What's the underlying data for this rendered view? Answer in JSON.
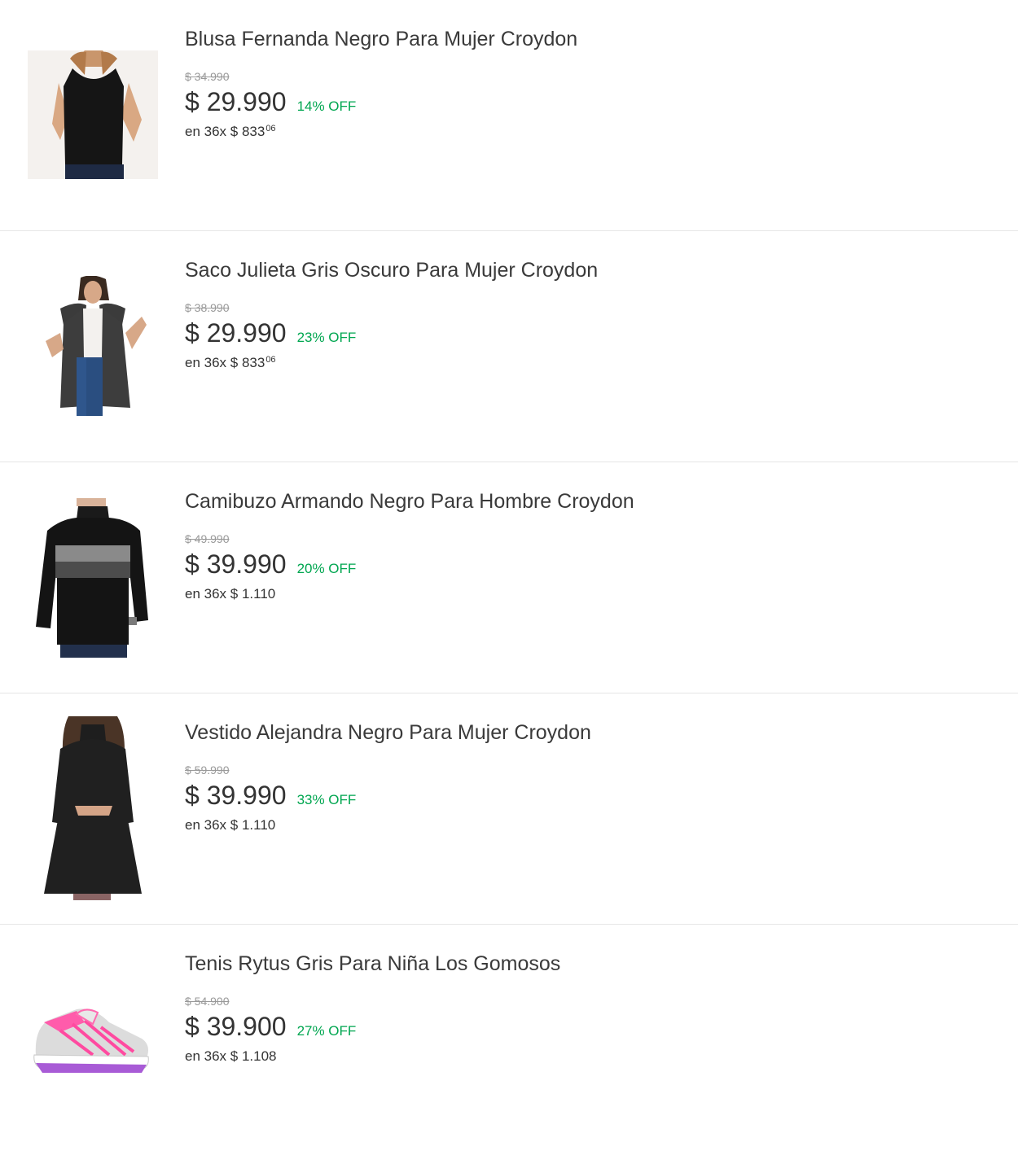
{
  "products": [
    {
      "title": "Blusa Fernanda Negro Para Mujer Croydon",
      "old_price": "$ 34.990",
      "price": "$ 29.990",
      "discount": "14% OFF",
      "installments": "en 36x $ 833",
      "installments_cents": "06",
      "image_icon": "black-tank-top-photo"
    },
    {
      "title": "Saco Julieta Gris Oscuro Para Mujer Croydon",
      "old_price": "$ 38.990",
      "price": "$ 29.990",
      "discount": "23% OFF",
      "installments": "en 36x $ 833",
      "installments_cents": "06",
      "image_icon": "gray-cardigan-photo"
    },
    {
      "title": "Camibuzo Armando Negro Para Hombre Croydon",
      "old_price": "$ 49.990",
      "price": "$ 39.990",
      "discount": "20% OFF",
      "installments": "en 36x $ 1.110",
      "installments_cents": "",
      "image_icon": "black-turtleneck-photo"
    },
    {
      "title": "Vestido Alejandra Negro Para Mujer Croydon",
      "old_price": "$ 59.990",
      "price": "$ 39.990",
      "discount": "33% OFF",
      "installments": "en 36x $ 1.110",
      "installments_cents": "",
      "image_icon": "black-dress-photo"
    },
    {
      "title": "Tenis Rytus Gris Para Niña Los Gomosos",
      "old_price": "$ 54.900",
      "price": "$ 39.900",
      "discount": "27% OFF",
      "installments": "en 36x $ 1.108",
      "installments_cents": "",
      "image_icon": "gray-pink-sneaker-photo"
    }
  ],
  "colors": {
    "discount": "#00a650",
    "old_price": "#999999",
    "divider": "#e6e6e6"
  }
}
